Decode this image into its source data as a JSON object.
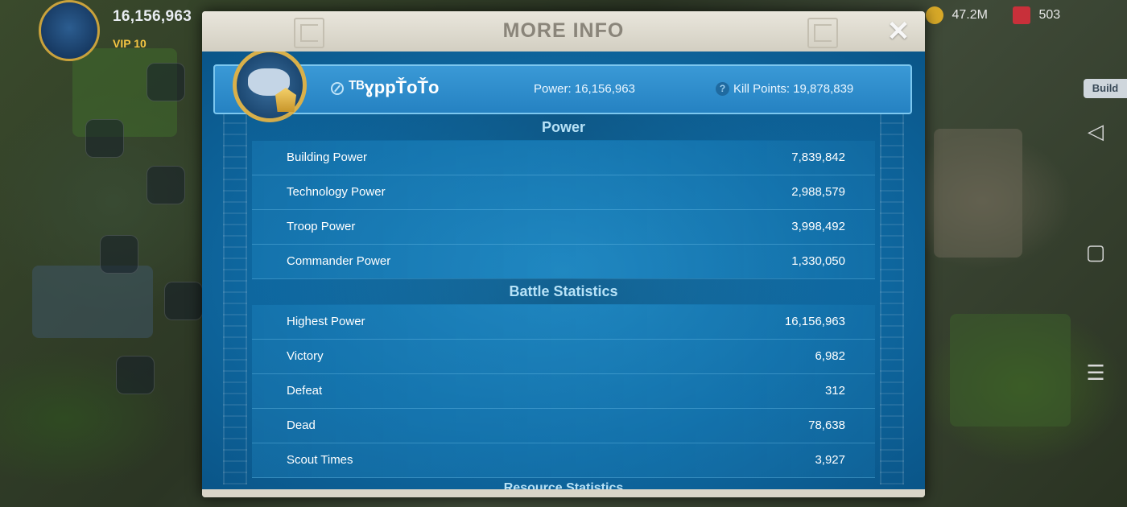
{
  "hud": {
    "power": "16,156,963",
    "vip": "VIP 10",
    "resource_1": "47.2M",
    "resource_2": "503",
    "build_label": "Build"
  },
  "modal": {
    "title": "MORE INFO",
    "close_symbol": "✕",
    "player": {
      "name": "ᵀᴮɣppŤoŤo",
      "power_label": "Power: 16,156,963",
      "kill_points_label": "Kill Points: 19,878,839",
      "help_symbol": "?"
    },
    "power_section": {
      "title": "Power",
      "rows": [
        {
          "label": "Building Power",
          "value": "7,839,842"
        },
        {
          "label": "Technology Power",
          "value": "2,988,579"
        },
        {
          "label": "Troop Power",
          "value": "3,998,492"
        },
        {
          "label": "Commander Power",
          "value": "1,330,050"
        }
      ]
    },
    "battle_section": {
      "title": "Battle Statistics",
      "rows": [
        {
          "label": "Highest Power",
          "value": "16,156,963"
        },
        {
          "label": "Victory",
          "value": "6,982"
        },
        {
          "label": "Defeat",
          "value": "312"
        },
        {
          "label": "Dead",
          "value": "78,638"
        },
        {
          "label": "Scout Times",
          "value": "3,927"
        }
      ]
    },
    "next_section_title": "Resource Statistics"
  },
  "icons": {
    "nav_back": "◁",
    "nav_home": "▢",
    "nav_menu": "☰"
  }
}
